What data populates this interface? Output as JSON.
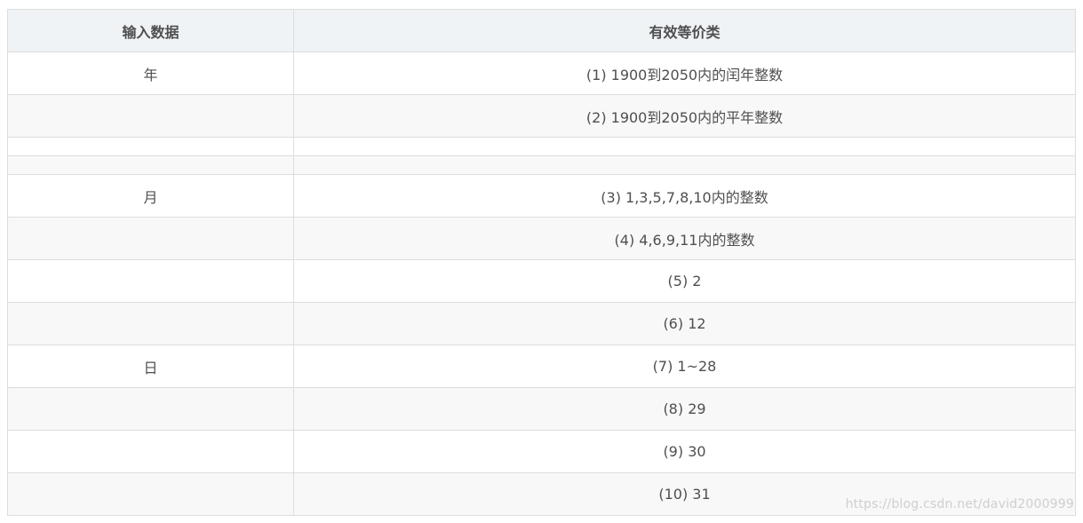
{
  "table": {
    "headers": [
      "输入数据",
      "有效等价类"
    ],
    "rows": [
      {
        "input": "年",
        "class": "(1) 1900到2050内的闰年整数"
      },
      {
        "input": "",
        "class": "(2) 1900到2050内的平年整数"
      },
      {
        "input": "",
        "class": ""
      },
      {
        "input": "",
        "class": ""
      },
      {
        "input": "月",
        "class": "(3) 1,3,5,7,8,10内的整数"
      },
      {
        "input": "",
        "class": "(4) 4,6,9,11内的整数"
      },
      {
        "input": "",
        "class": "(5) 2"
      },
      {
        "input": "",
        "class": "(6) 12"
      },
      {
        "input": "日",
        "class": "(7) 1~28"
      },
      {
        "input": "",
        "class": "(8) 29"
      },
      {
        "input": "",
        "class": "(9) 30"
      },
      {
        "input": "",
        "class": "(10) 31"
      }
    ]
  },
  "watermark": "https://blog.csdn.net/david2000999"
}
